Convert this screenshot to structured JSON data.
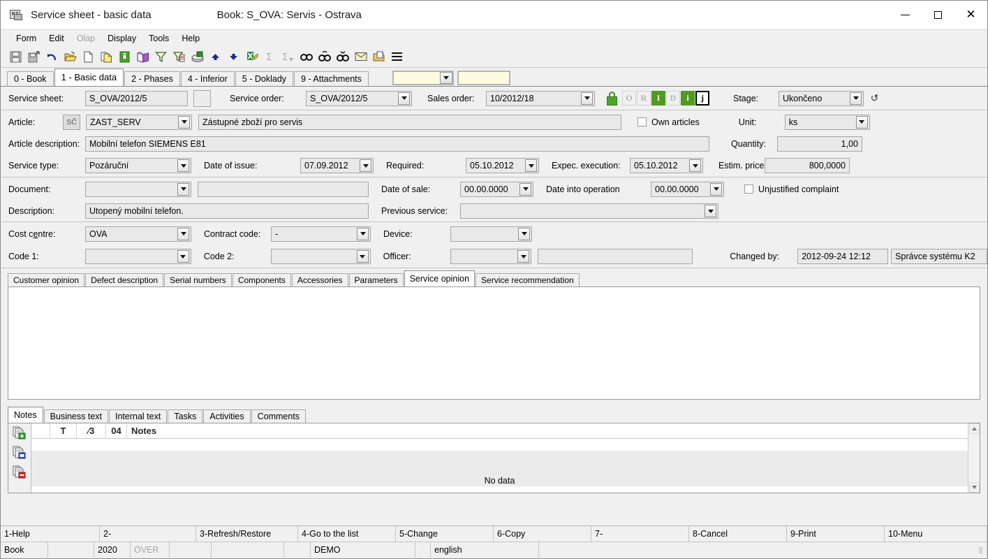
{
  "window": {
    "title": "Service sheet - basic data",
    "book_label": "Book: S_OVA: Servis - Ostrava",
    "minimize": "—",
    "maximize": "□",
    "close": "✕"
  },
  "menu": [
    {
      "label": "Form",
      "disabled": false
    },
    {
      "label": "Edit",
      "disabled": false
    },
    {
      "label": "Olap",
      "disabled": true
    },
    {
      "label": "Display",
      "disabled": false
    },
    {
      "label": "Tools",
      "disabled": false
    },
    {
      "label": "Help",
      "disabled": false
    }
  ],
  "toolbar": [
    {
      "name": "save-icon"
    },
    {
      "name": "save-close-icon"
    },
    {
      "name": "undo-icon"
    },
    {
      "name": "open-folder-icon"
    },
    {
      "name": "new-document-icon"
    },
    {
      "name": "copy-document-icon"
    },
    {
      "name": "lock-icon"
    },
    {
      "name": "book-icon"
    },
    {
      "name": "filter-icon"
    },
    {
      "name": "filter-edit-icon"
    },
    {
      "name": "print-icon"
    },
    {
      "name": "move-up-icon"
    },
    {
      "name": "move-down-icon"
    },
    {
      "name": "export-excel-icon"
    },
    {
      "name": "sum-icon"
    },
    {
      "name": "sum-filter-icon"
    },
    {
      "name": "find-icon"
    },
    {
      "name": "find-next-icon"
    },
    {
      "name": "find-prev-icon"
    },
    {
      "name": "mail-icon"
    },
    {
      "name": "notes-folder-icon"
    },
    {
      "name": "menu-lines-icon"
    }
  ],
  "tabs": [
    {
      "label": "0 - Book",
      "active": false
    },
    {
      "label": "1 - Basic data",
      "active": true
    },
    {
      "label": "2 - Phases",
      "active": false
    },
    {
      "label": "4 - Inferior",
      "active": false
    },
    {
      "label": "5 - Doklady",
      "active": false
    },
    {
      "label": "9 - Attachments",
      "active": false
    }
  ],
  "quickfields": {
    "combo_value": "",
    "text_value": ""
  },
  "form": {
    "service_sheet_label": "Service sheet:",
    "service_sheet_value": "S_OVA/2012/5",
    "service_order_label": "Service order:",
    "service_order_value": "S_OVA/2012/5",
    "sales_order_label": "Sales order:",
    "sales_order_value": "10/2012/18",
    "stage_label": "Stage:",
    "stage_value": "Ukončeno",
    "status_flags": [
      {
        "letter": "O",
        "state": "off"
      },
      {
        "letter": "R",
        "state": "off"
      },
      {
        "letter": "I",
        "state": "on"
      },
      {
        "letter": "D",
        "state": "off"
      },
      {
        "letter": "i",
        "state": "on"
      },
      {
        "letter": "j",
        "state": "current"
      }
    ],
    "article_label": "Article:",
    "article_button": "SČ",
    "article_code": "ZAST_SERV",
    "article_name": "Zástupné zboží pro servis",
    "own_articles_label": "Own articles",
    "own_articles_checked": false,
    "unit_label": "Unit:",
    "unit_value": "ks",
    "article_description_label": "Article description:",
    "article_description_value": "Mobilní telefon SIEMENS E81",
    "quantity_label": "Quantity:",
    "quantity_value": "1,00",
    "service_type_label": "Service type:",
    "service_type_value": "Pozáruční",
    "date_of_issue_label": "Date of issue:",
    "date_of_issue_value": "07.09.2012",
    "required_label": "Required:",
    "required_value": "05.10.2012",
    "expec_execution_label": "Expec. execution:",
    "expec_execution_value": "05.10.2012",
    "estim_price_label": "Estim. price:",
    "estim_price_value": "800,0000",
    "document_label": "Document:",
    "document_value": "",
    "document_text_value": "",
    "date_of_sale_label": "Date of sale:",
    "date_of_sale_value": "00.00.0000",
    "date_into_operation_label": "Date into operation",
    "date_into_operation_value": "00.00.0000",
    "unjustified_complaint_label": "Unjustified complaint",
    "unjustified_complaint_checked": false,
    "description_label": "Description:",
    "description_value": "Utopený mobilní telefon.",
    "previous_service_label": "Previous service:",
    "previous_service_value": "",
    "cost_centre_label": "Cost centre:",
    "cost_centre_value": "OVA",
    "contract_code_label": "Contract code:",
    "contract_code_value": "-",
    "device_label": "Device:",
    "device_value": "",
    "code1_label": "Code 1:",
    "code1_value": "",
    "code2_label": "Code 2:",
    "code2_value": "",
    "officer_label": "Officer:",
    "officer_value": "",
    "officer_text_value": "",
    "changed_by_label": "Changed by:",
    "changed_by_date": "2012-09-24 12:12",
    "changed_by_user": "Správce systému K2"
  },
  "opinion_tabs": [
    {
      "label": "Customer opinion",
      "active": false
    },
    {
      "label": "Defect description",
      "active": false
    },
    {
      "label": "Serial numbers",
      "active": false
    },
    {
      "label": "Components",
      "active": false
    },
    {
      "label": "Accessories",
      "active": false
    },
    {
      "label": "Parameters",
      "active": false
    },
    {
      "label": "Service opinion",
      "active": true
    },
    {
      "label": "Service recommendation",
      "active": false
    }
  ],
  "opinion_text": "",
  "notes_tabs": [
    {
      "label": "Notes",
      "active": true
    },
    {
      "label": "Business text",
      "active": false
    },
    {
      "label": "Internal text",
      "active": false
    },
    {
      "label": "Tasks",
      "active": false
    },
    {
      "label": "Activities",
      "active": false
    },
    {
      "label": "Comments",
      "active": false
    }
  ],
  "notes_gutter": [
    {
      "name": "add-note-icon"
    },
    {
      "name": "view-note-icon"
    },
    {
      "name": "delete-note-icon"
    }
  ],
  "notes_grid": {
    "columns": [
      "T",
      "⁄3",
      "04",
      "Notes"
    ],
    "rows": [],
    "empty_text": "No data"
  },
  "function_keys": [
    "1-Help",
    "2-",
    "3-Refresh/Restore",
    "4-Go to the list",
    "5-Change",
    "6-Copy",
    "7-",
    "8-Cancel",
    "9-Print",
    "10-Menu"
  ],
  "status_bar": {
    "book": "Book",
    "blank1": "",
    "year": "2020",
    "over": "OVER",
    "blank2": "",
    "blank3": "",
    "blank4": "",
    "demo": "DEMO",
    "blank5": "",
    "language": "english"
  }
}
